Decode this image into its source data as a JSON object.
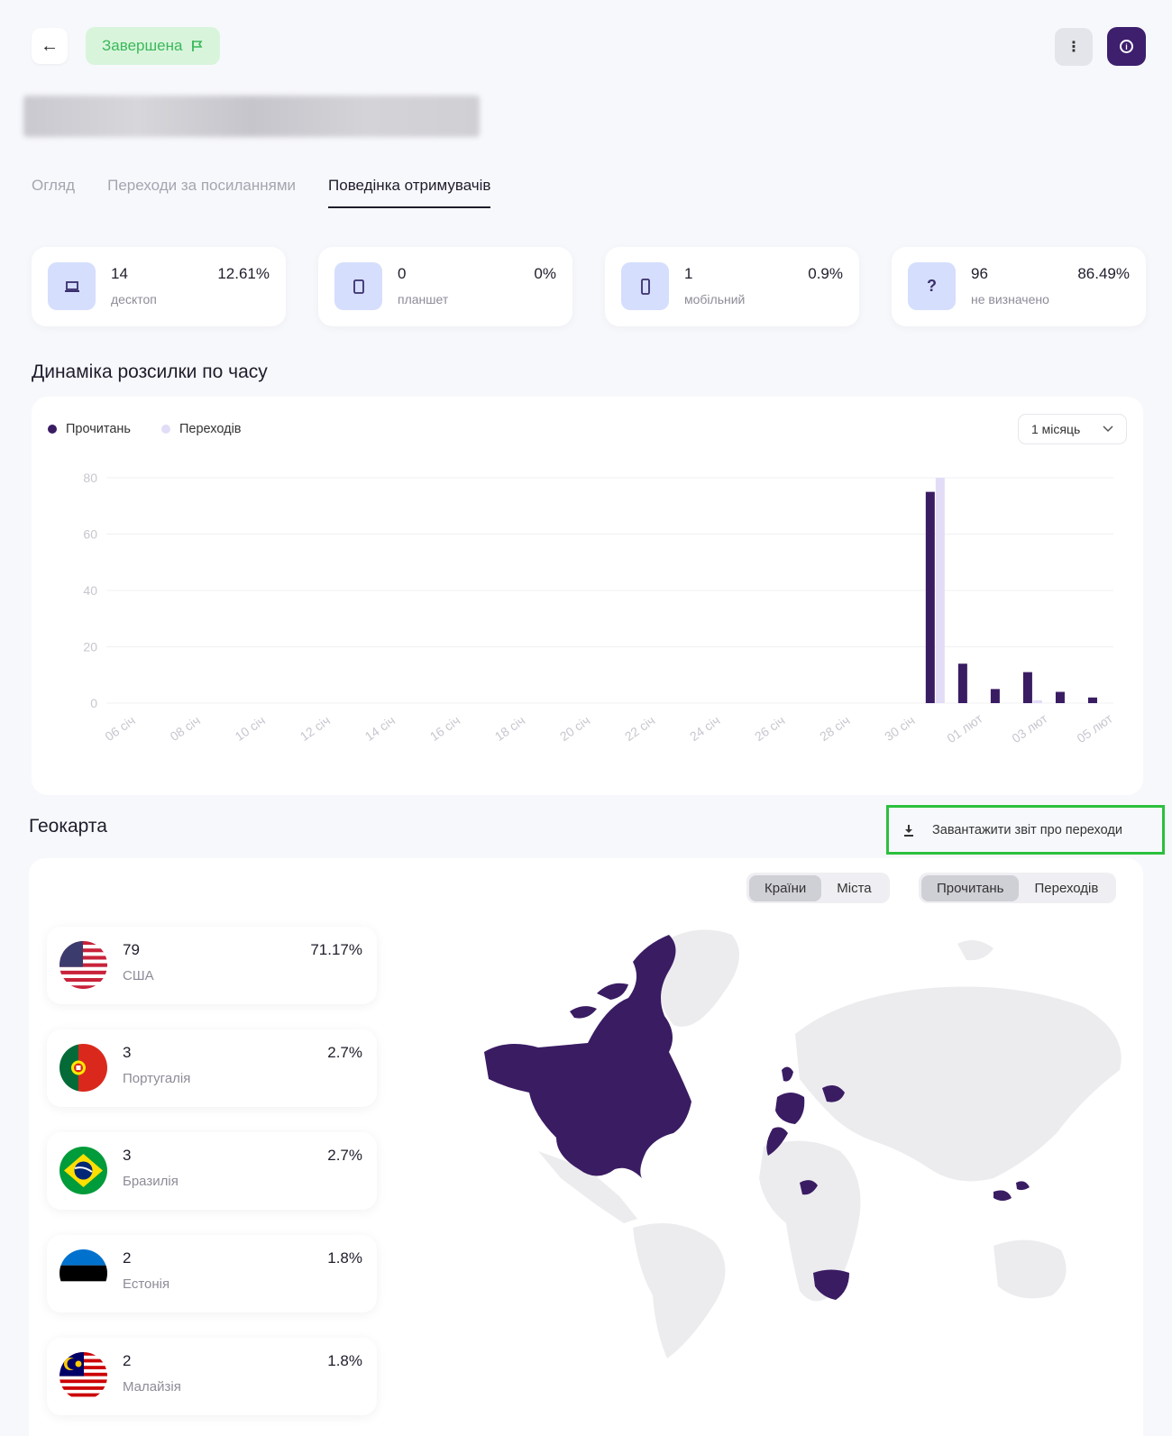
{
  "header": {
    "back_icon": "arrow-left-icon",
    "status_label": "Завершена",
    "status_icon": "flag-icon",
    "more_icon": "vertical-dots-icon",
    "info_icon": "info-icon",
    "colors": {
      "status_bg": "#d8f5dc",
      "status_text": "#3cb85a",
      "primary": "#3d1f6e"
    }
  },
  "tabs": [
    {
      "label": "Огляд",
      "active": false
    },
    {
      "label": "Переходи за посиланнями",
      "active": false
    },
    {
      "label": "Поведінка отримувачів",
      "active": true
    }
  ],
  "devices": [
    {
      "icon": "laptop-icon",
      "count": "14",
      "label": "десктоп",
      "percent": "12.61%"
    },
    {
      "icon": "tablet-icon",
      "count": "0",
      "label": "планшет",
      "percent": "0%"
    },
    {
      "icon": "mobile-icon",
      "count": "1",
      "label": "мобільний",
      "percent": "0.9%"
    },
    {
      "icon": "question-icon",
      "icon_text": "?",
      "count": "96",
      "label": "не визначено",
      "percent": "86.49%"
    }
  ],
  "timeline": {
    "title": "Динаміка розсилки по часу",
    "legend": [
      {
        "label": "Прочитань",
        "color": "#3a1c63"
      },
      {
        "label": "Переходів",
        "color": "#e2dcf7"
      }
    ],
    "period": "1 місяць"
  },
  "chart_data": {
    "type": "bar",
    "x": [
      "06 січ",
      "07 січ",
      "08 січ",
      "09 січ",
      "10 січ",
      "11 січ",
      "12 січ",
      "13 січ",
      "14 січ",
      "15 січ",
      "16 січ",
      "17 січ",
      "18 січ",
      "19 січ",
      "20 січ",
      "21 січ",
      "22 січ",
      "23 січ",
      "24 січ",
      "25 січ",
      "26 січ",
      "27 січ",
      "28 січ",
      "29 січ",
      "30 січ",
      "31 січ",
      "01 лют",
      "02 лют",
      "03 лют",
      "04 лют",
      "05 лют"
    ],
    "xticks": [
      "06 січ",
      "08 січ",
      "10 січ",
      "12 січ",
      "14 січ",
      "16 січ",
      "18 січ",
      "20 січ",
      "22 січ",
      "24 січ",
      "26 січ",
      "28 січ",
      "30 січ",
      "01 лют",
      "03 лют",
      "05 лют"
    ],
    "yticks": [
      0,
      20,
      40,
      60,
      80
    ],
    "ylim": [
      0,
      80
    ],
    "series": [
      {
        "name": "Прочитань",
        "color": "#3a1c63",
        "values": [
          0,
          0,
          0,
          0,
          0,
          0,
          0,
          0,
          0,
          0,
          0,
          0,
          0,
          0,
          0,
          0,
          0,
          0,
          0,
          0,
          0,
          0,
          0,
          0,
          0,
          75,
          14,
          5,
          11,
          4,
          2
        ]
      },
      {
        "name": "Переходів",
        "color": "#e2dcf7",
        "values": [
          0,
          0,
          0,
          0,
          0,
          0,
          0,
          0,
          0,
          0,
          0,
          0,
          0,
          0,
          0,
          0,
          0,
          0,
          0,
          0,
          0,
          0,
          0,
          0,
          0,
          80,
          0,
          0,
          1,
          0,
          0
        ]
      }
    ]
  },
  "geo": {
    "title": "Геокарта",
    "download_label": "Завантажити звіт про переходи",
    "download_icon": "download-icon",
    "scope_toggle": [
      {
        "label": "Країни",
        "active": true
      },
      {
        "label": "Міста",
        "active": false
      }
    ],
    "metric_toggle": [
      {
        "label": "Прочитань",
        "active": true
      },
      {
        "label": "Переходів",
        "active": false
      }
    ],
    "countries": [
      {
        "flag": "usa-flag-icon",
        "count": "79",
        "name": "США",
        "percent": "71.17%"
      },
      {
        "flag": "portugal-flag-icon",
        "count": "3",
        "name": "Португалія",
        "percent": "2.7%"
      },
      {
        "flag": "brazil-flag-icon",
        "count": "3",
        "name": "Бразилія",
        "percent": "2.7%"
      },
      {
        "flag": "estonia-flag-icon",
        "count": "2",
        "name": "Естонія",
        "percent": "1.8%"
      },
      {
        "flag": "malaysia-flag-icon",
        "count": "2",
        "name": "Малайзія",
        "percent": "1.8%"
      }
    ],
    "map_colors": {
      "highlight": "#3a1c63",
      "base": "#ececef"
    }
  }
}
